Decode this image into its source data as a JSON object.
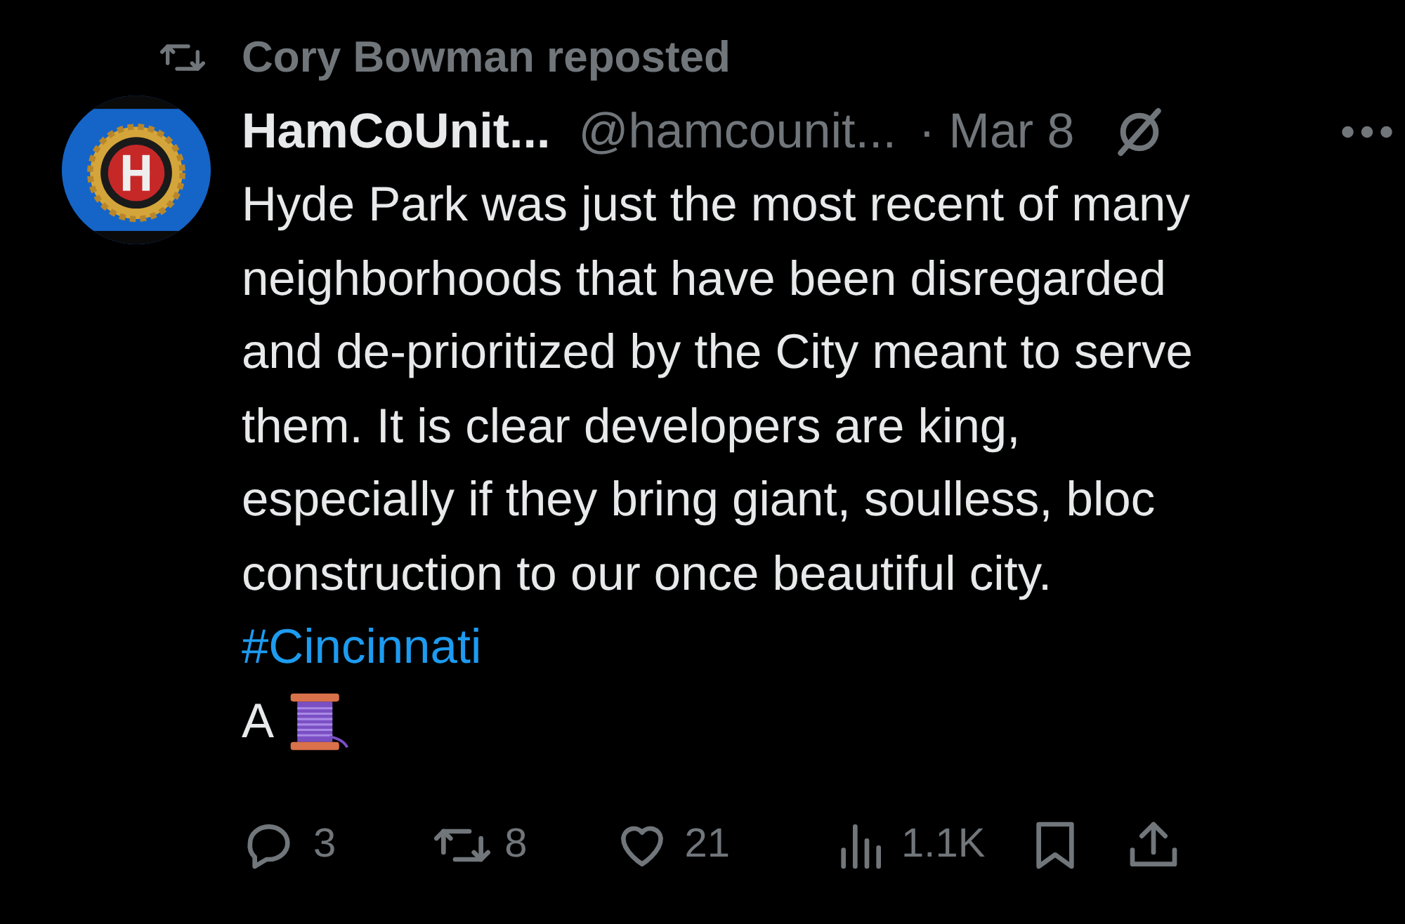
{
  "repost": {
    "text": "Cory Bowman reposted"
  },
  "post": {
    "display_name": "HamCoUnit...",
    "handle": "@hamcounit...",
    "date": "· Mar 8",
    "body_lines": [
      "Hyde Park was just the most recent of many",
      "neighborhoods that have been disregarded",
      "and de-prioritized by the City meant to serve",
      "them. It is clear developers are king,",
      "especially if they bring giant, soulless, bloc",
      "construction to our once beautiful city."
    ],
    "hashtag": "#Cincinnati",
    "last_line": "A"
  },
  "actions": [
    {
      "kind": "reply",
      "count": "3"
    },
    {
      "kind": "repost",
      "count": "8"
    },
    {
      "kind": "like",
      "count": "21"
    },
    {
      "kind": "views",
      "count": "1.1K"
    },
    {
      "kind": "bookmark"
    },
    {
      "kind": "share"
    }
  ]
}
